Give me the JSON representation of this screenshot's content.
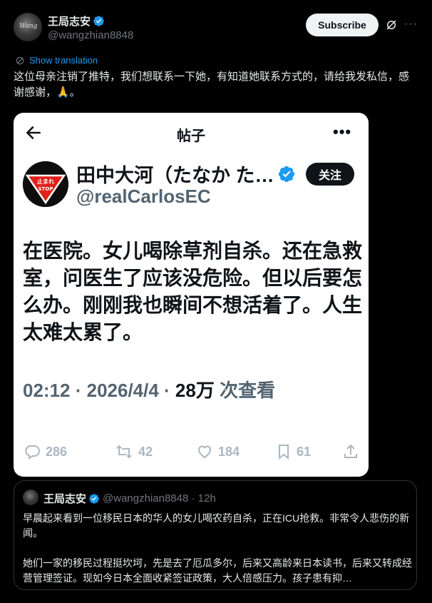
{
  "author": {
    "name": "王局志安",
    "handle": "@wangzhian8848",
    "subscribe_label": "Subscribe"
  },
  "translate_label": "Show translation",
  "tweet_text": "这位母亲注销了推特，我们想联系一下她，有知道她联系方式的，请给我发私信，感谢感谢，🙏。",
  "screenshot": {
    "title": "帖子",
    "name": "田中大河（たなか た…",
    "handle": "@realCarlosEC",
    "follow_label": "关注",
    "avatar_sign_top": "止まれ",
    "avatar_sign_bottom": "STOP",
    "body": "在医院。女儿喝除草剂自杀。还在急救室，问医生了应该没危险。但以后要怎么办。刚刚我也瞬间不想活着了。人生太难太累了。",
    "meta_time": "02:12 · 2026/4/4 · ",
    "meta_views": "28万",
    "meta_views_label": " 次查看",
    "replies": "286",
    "reposts": "42",
    "likes": "184",
    "bookmarks": "61"
  },
  "quote": {
    "name": "王局志安",
    "handle": "@wangzhian8848 · 12h",
    "paragraph1": "早晨起来看到一位移民日本的华人的女儿喝农药自杀，正在ICU抢救。非常令人悲伤的新闻。",
    "paragraph2": "她们一家的移民过程挺坎坷，先是去了厄瓜多尔，后来又高龄来日本读书，后来又转成经营管理签证。现如今日本全面收紧签证政策，大人倍感压力。孩子患有抑…"
  },
  "colors": {
    "background": "#000000",
    "accent": "#1d9bf0",
    "verified": "#1d9bf0",
    "muted": "#71767b"
  }
}
